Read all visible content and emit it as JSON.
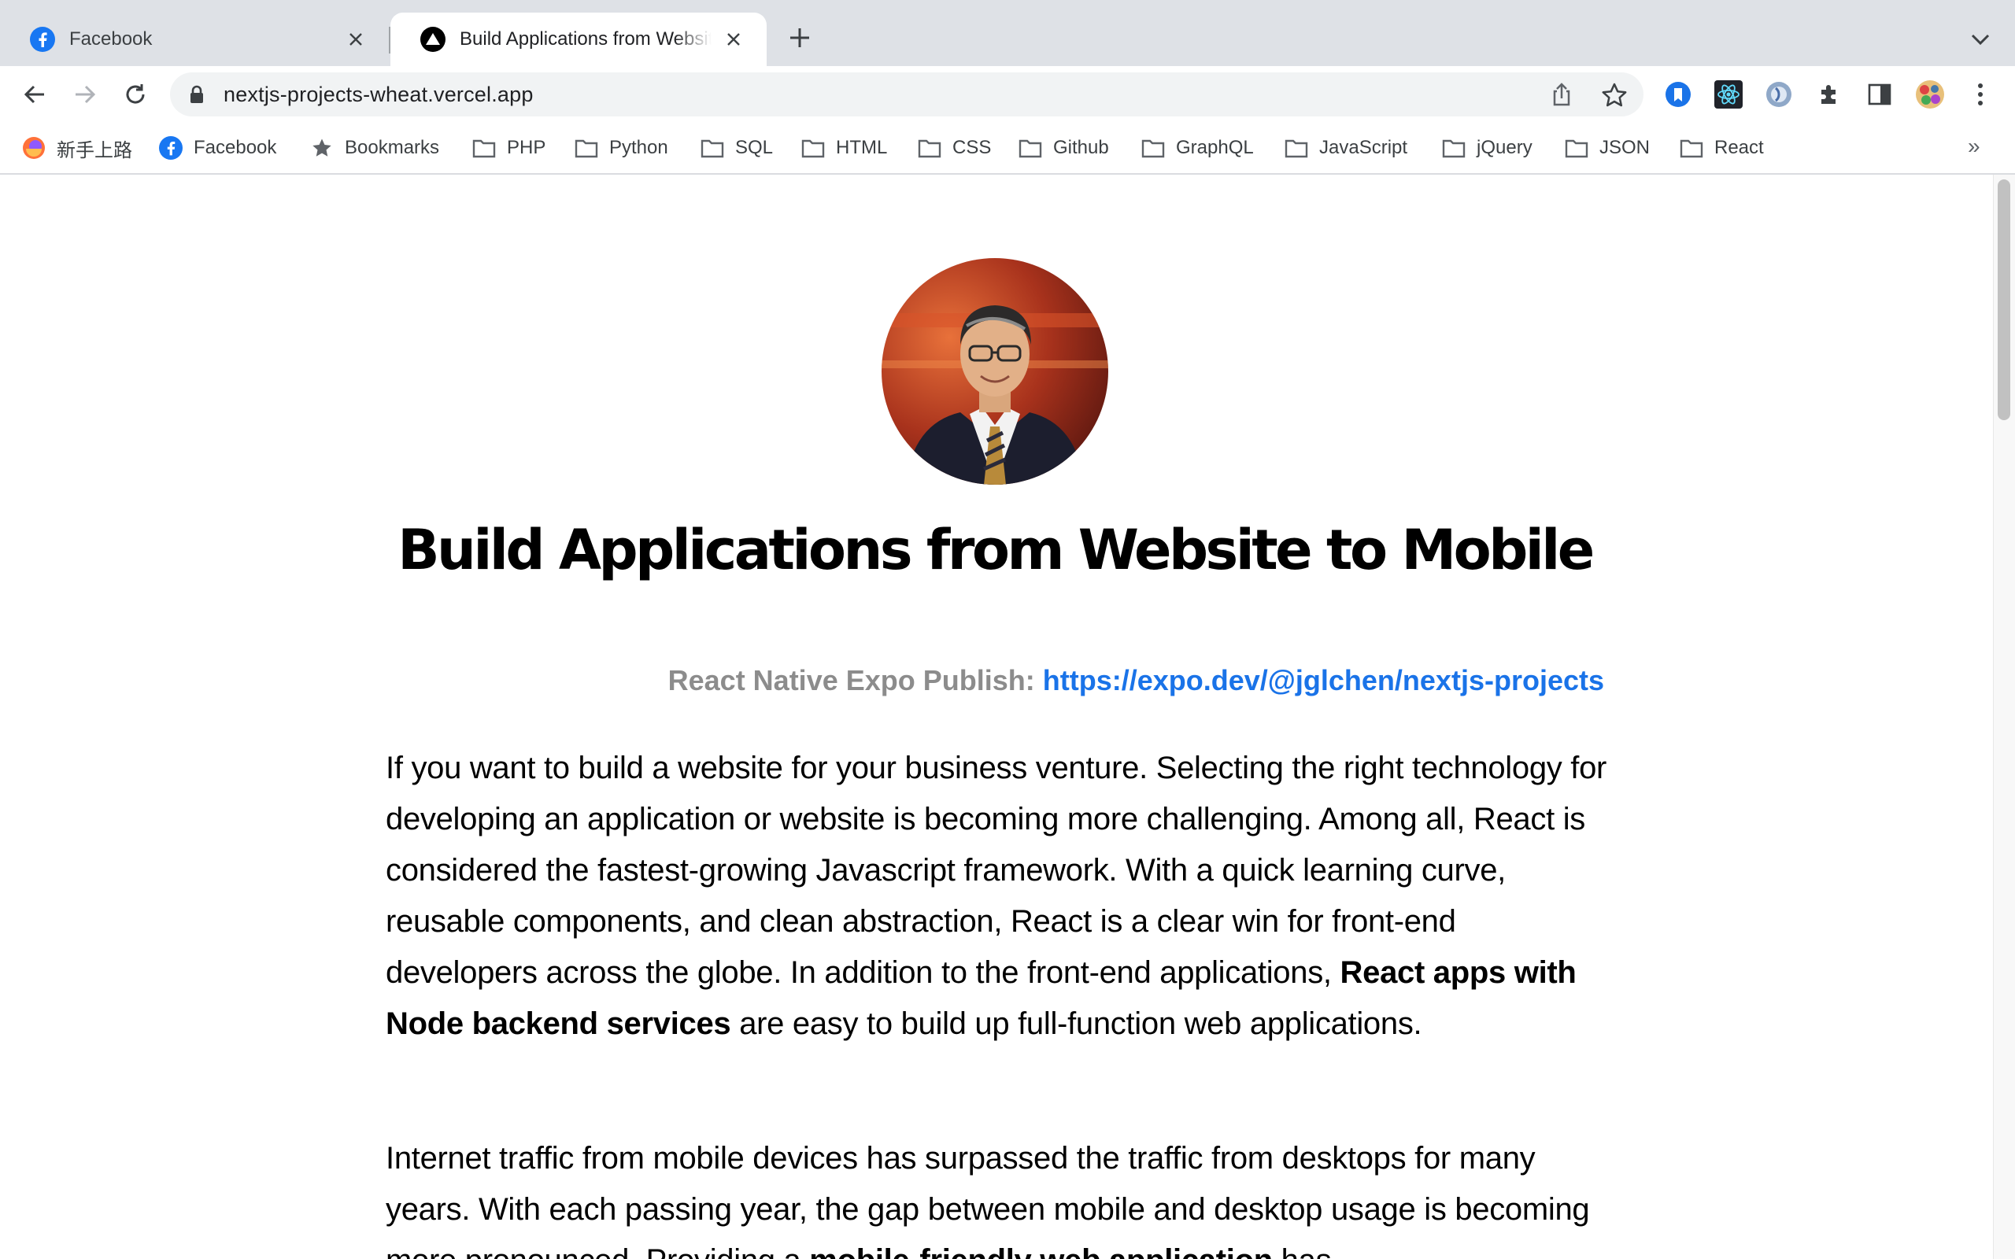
{
  "tabs": [
    {
      "title": "Facebook",
      "icon": "facebook-icon",
      "active": false
    },
    {
      "title": "Build Applications from Website to Mobile",
      "icon": "vercel-icon",
      "active": true
    }
  ],
  "toolbar": {
    "url": "nextjs-projects-wheat.vercel.app"
  },
  "bookmarks": [
    {
      "label": "新手上路",
      "icon": "firefox-icon"
    },
    {
      "label": "Facebook",
      "icon": "facebook-icon"
    },
    {
      "label": "Bookmarks",
      "icon": "star-icon"
    },
    {
      "label": "PHP",
      "icon": "folder-icon"
    },
    {
      "label": "Python",
      "icon": "folder-icon"
    },
    {
      "label": "SQL",
      "icon": "folder-icon"
    },
    {
      "label": "HTML",
      "icon": "folder-icon"
    },
    {
      "label": "CSS",
      "icon": "folder-icon"
    },
    {
      "label": "Github",
      "icon": "folder-icon"
    },
    {
      "label": "GraphQL",
      "icon": "folder-icon"
    },
    {
      "label": "JavaScript",
      "icon": "folder-icon"
    },
    {
      "label": "jQuery",
      "icon": "folder-icon"
    },
    {
      "label": "JSON",
      "icon": "folder-icon"
    },
    {
      "label": "React",
      "icon": "folder-icon"
    }
  ],
  "bookmarks_more": "»",
  "page": {
    "headline": "Build Applications from Website to Mobile",
    "expo_label": "React Native Expo Publish:",
    "expo_link": "https://expo.dev/@jglchen/nextjs-projects",
    "p1_a": "If you want to build a website for your business venture. Selecting the right technology for developing an application or website is becoming more challenging. Among all, React is considered the fastest-growing Javascript framework. With a quick learning curve, reusable components, and clean abstraction, React is a clear win for front-end developers across the globe. In addition to the front-end applications, ",
    "p1_bold": "React apps with Node backend services",
    "p1_b": " are easy to build up full-function web applications.",
    "p2_a": "Internet traffic from mobile devices has surpassed the traffic from desktops for many years. With each passing year, the gap between mobile and desktop usage is becoming more pronounced. Providing a ",
    "p2_bold": "mobile-friendly web application",
    "p2_b": " has"
  },
  "colors": {
    "tabstrip": "#dee1e6",
    "link": "#1a73e8",
    "muted_label": "#8c8c8c",
    "facebook": "#1877f2"
  }
}
